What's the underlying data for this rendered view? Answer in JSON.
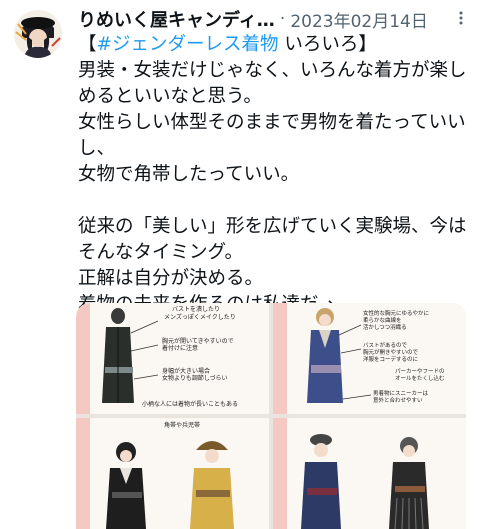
{
  "tweet": {
    "author_name": "りめいく屋キャンディ…",
    "separator": "·",
    "date": "2023年02月14日",
    "hashtag": "#ジェンダーレス着物",
    "hashtag_suffix": " いろいろ】",
    "open_bracket": "【",
    "lines": [
      "男装・女装だけじゃなく、いろんな着方が楽し",
      "めるといいなと思う。",
      "女性らしい体型そのままで男物を着たっていい",
      "し、",
      "女物で角帯したっていい。",
      "",
      "従来の「美しい」形を広げていく実験場、今は",
      "そんなタイミング。",
      "正解は自分が決める。",
      "着物の未来を作るのは私達だ→"
    ]
  },
  "media": {
    "tile1": {
      "notes": [
        "バストを潰したり",
        "メンズっぽくメイクしたり",
        "胸元が開いてきやすいので",
        "着付けに注意",
        "身幅が大きい場合",
        "女物よりも調節しづらい",
        "小柄な人には着物が長いこともある"
      ]
    },
    "tile2": {
      "notes": [
        "女性的な胸元にゆるやかに",
        "柔らかな曲線を",
        "活かしつつ羽織る",
        "バストがあるので",
        "胸元が開きやすいので",
        "洋服をコーデするのに",
        "パーカーやフードの",
        "オールをたくし込む",
        "男着物にスニーカーは",
        "意外と合わせやすい"
      ]
    },
    "tile3": {
      "notes": [
        "角帯や兵児帯"
      ]
    },
    "colors": {
      "tile_bg": "#fbf7f3",
      "accent_pink": "#f4c9c4"
    }
  },
  "icons": {
    "more": "three-dots-icon"
  }
}
